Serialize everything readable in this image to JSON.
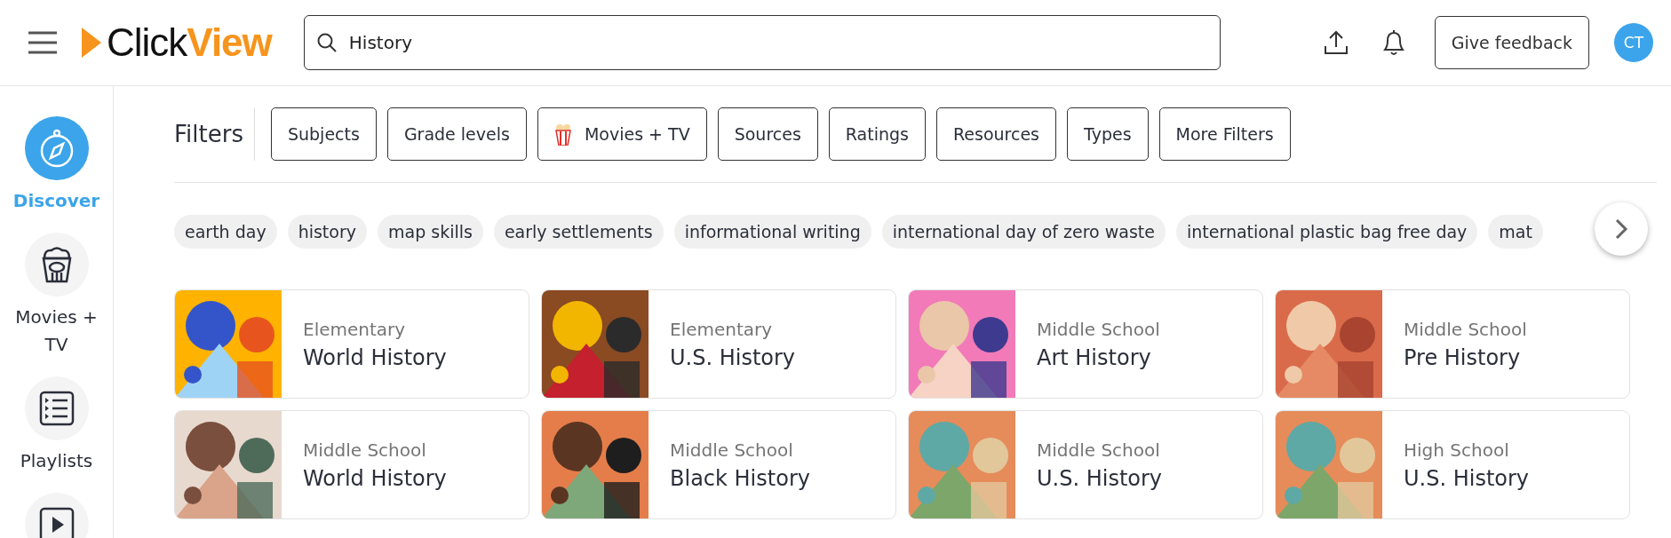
{
  "header": {
    "logo": {
      "first": "Click",
      "second": "View"
    },
    "search": {
      "value": "History"
    },
    "feedback_button": "Give feedback",
    "avatar": "CT"
  },
  "sidebar": {
    "items": [
      {
        "label": "Discover",
        "selected": true
      },
      {
        "label": "Movies + TV",
        "selected": false
      },
      {
        "label": "Playlists",
        "selected": false
      },
      {
        "selected": false
      }
    ]
  },
  "filters": {
    "title": "Filters",
    "buttons": [
      {
        "label": "Subjects"
      },
      {
        "label": "Grade levels"
      },
      {
        "label": "Movies + TV",
        "kind": "icon"
      },
      {
        "label": "Sources"
      },
      {
        "label": "Ratings"
      },
      {
        "label": "Resources"
      },
      {
        "label": "Types"
      },
      {
        "label": "More Filters"
      }
    ]
  },
  "tags": [
    "earth day",
    "history",
    "map skills",
    "early settlements",
    "informational writing",
    "international day of zero waste",
    "international plastic bag free day",
    "mat"
  ],
  "cards": [
    {
      "level": "Elementary",
      "title": "World History"
    },
    {
      "level": "Elementary",
      "title": "U.S. History"
    },
    {
      "level": "Middle School",
      "title": "Art History"
    },
    {
      "level": "Middle School",
      "title": "Pre History"
    },
    {
      "level": "Middle School",
      "title": "World History"
    },
    {
      "level": "Middle School",
      "title": "Black History"
    },
    {
      "level": "Middle School",
      "title": "U.S. History"
    },
    {
      "level": "High School",
      "title": "U.S. History"
    }
  ]
}
